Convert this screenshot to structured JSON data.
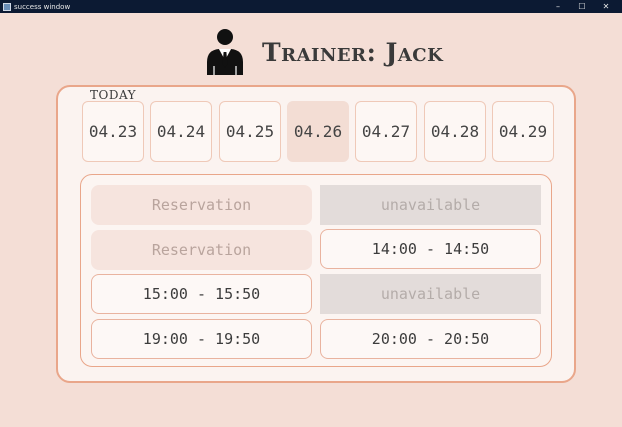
{
  "window": {
    "title": "success window",
    "minimize": "–",
    "maximize": "☐",
    "close": "✕"
  },
  "header": {
    "title": "Trainer: Jack"
  },
  "today_label": "TODAY",
  "dates": [
    "04.23",
    "04.24",
    "04.25",
    "04.26",
    "04.27",
    "04.28",
    "04.29"
  ],
  "selected_date_index": 3,
  "slots": [
    {
      "label": "Reservation",
      "state": "reserved"
    },
    {
      "label": "unavailable",
      "state": "unavailable"
    },
    {
      "label": "Reservation",
      "state": "reserved"
    },
    {
      "label": "14:00 - 14:50",
      "state": "open"
    },
    {
      "label": "15:00 - 15:50",
      "state": "open"
    },
    {
      "label": "unavailable",
      "state": "unavailable"
    },
    {
      "label": "19:00 - 19:50",
      "state": "open"
    },
    {
      "label": "20:00 - 20:50",
      "state": "open"
    }
  ]
}
